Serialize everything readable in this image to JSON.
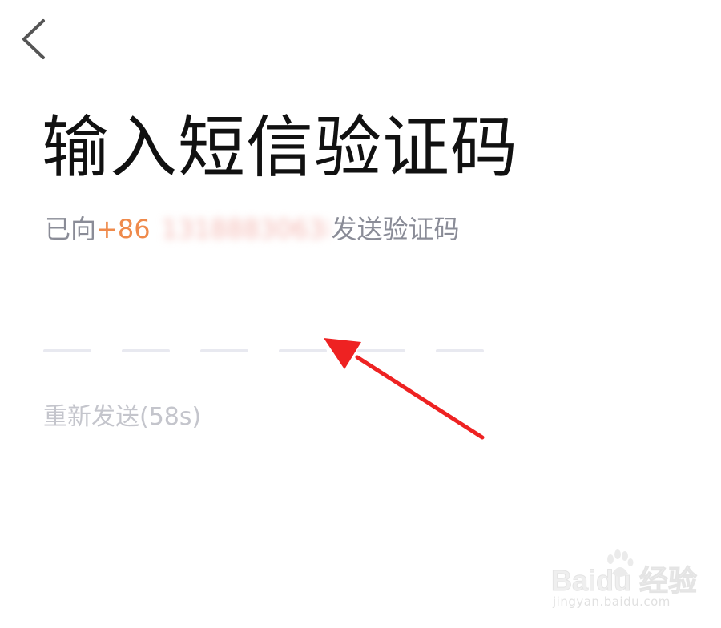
{
  "header": {
    "back_icon": "chevron-left-icon"
  },
  "page": {
    "title": "输入短信验证码",
    "subtitle_prefix": "已向",
    "country_code": "+86",
    "phone_number": "13188830638",
    "subtitle_suffix": "发送验证码"
  },
  "code_input": {
    "slot_count": 6
  },
  "resend": {
    "label": "重新发送(58s)"
  },
  "annotation": {
    "arrow_icon": "red-arrow-annotation",
    "color": "#ee2222"
  },
  "watermark": {
    "logo_text": "Baidu 经验",
    "url": "jingyan.baidu.com"
  },
  "colors": {
    "title": "#111111",
    "subtitle": "#8a8c97",
    "country_code": "#ef8a4b",
    "slot": "#e8e9f0",
    "resend": "#c4c5cc"
  }
}
